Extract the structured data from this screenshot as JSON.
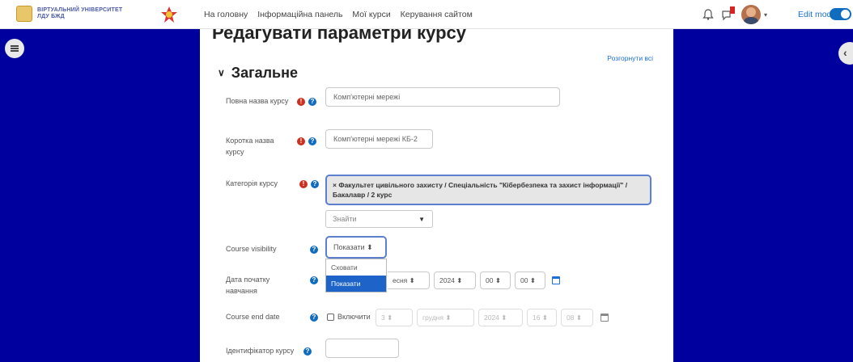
{
  "header": {
    "logo_text": "ВІРТУАЛЬНИЙ УНІВЕРСИТЕТ ЛДУ БЖД",
    "nav_links": [
      "На головну",
      "Інформаційна панель",
      "Мої курси",
      "Керування сайтом"
    ],
    "edit_mode_label": "Edit mode"
  },
  "page": {
    "title": "Редагувати параметри курсу",
    "expand_all": "Розгорнути всі",
    "section_title": "Загальне"
  },
  "form": {
    "fullname_label": "Повна назва курсу",
    "fullname_value": "Комп'ютерні мережі",
    "shortname_label": "Коротка назва курсу",
    "shortname_value": "Комп'ютерні мережі КБ-2",
    "category_label": "Категорія курсу",
    "category_value": "× Факультет цивільного захисту / Спеціальність \"Кібербезпека та захист інформації\" / Бакалавр / 2 курс",
    "category_search": "Знайти",
    "visibility_label": "Course visibility",
    "visibility_value": "Показати ⬍",
    "visibility_options": [
      "Сховати",
      "Показати"
    ],
    "startdate_label": "Дата початку навчання",
    "startdate_month": "есня ⬍",
    "startdate_year": "2024 ⬍",
    "startdate_hour": "00 ⬍",
    "startdate_min": "00 ⬍",
    "enddate_label": "Course end date",
    "enddate_enable": "Включити",
    "enddate_day": "3 ⬍",
    "enddate_month": "грудня ⬍",
    "enddate_year": "2024 ⬍",
    "enddate_hour": "16 ⬍",
    "enddate_min": "08 ⬍",
    "idnumber_label": "Ідентифікатор курсу"
  },
  "colors": {
    "background": "#00009e",
    "accent": "#0f6cbf",
    "required": "#ca3120"
  }
}
